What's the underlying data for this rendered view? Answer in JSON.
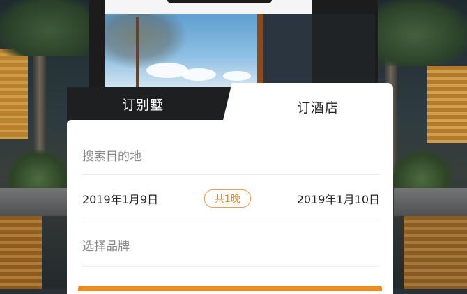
{
  "tabs": {
    "villa_label": "订别墅",
    "hotel_label": "订酒店",
    "active": "hotel"
  },
  "form": {
    "destination_placeholder": "搜索目的地",
    "checkin_date": "2019年1月9日",
    "nights_badge": "共1晚",
    "checkout_date": "2019年1月10日",
    "brand_placeholder": "选择品牌"
  },
  "colors": {
    "accent": "#f08a1e",
    "tab_inactive_bg": "#1d1f21",
    "tab_active_bg": "#ffffff"
  }
}
